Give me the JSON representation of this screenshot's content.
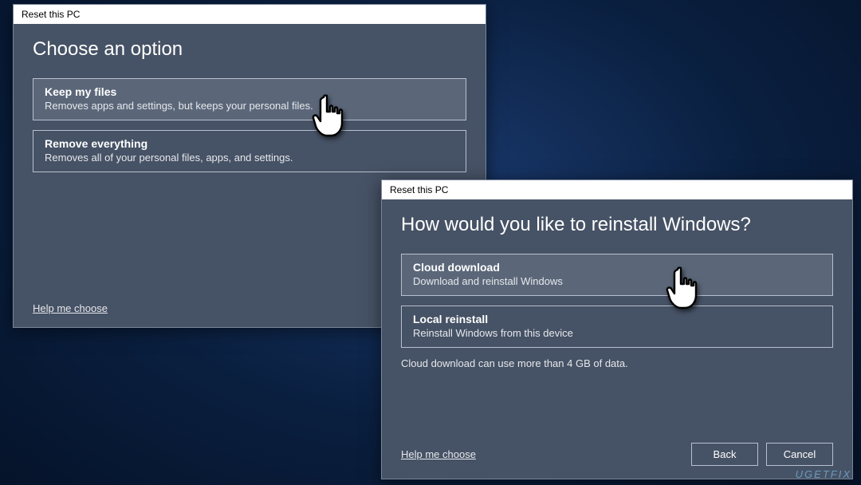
{
  "dialog1": {
    "title": "Reset this PC",
    "heading": "Choose an option",
    "options": [
      {
        "title": "Keep my files",
        "desc": "Removes apps and settings, but keeps your personal files."
      },
      {
        "title": "Remove everything",
        "desc": "Removes all of your personal files, apps, and settings."
      }
    ],
    "help": "Help me choose"
  },
  "dialog2": {
    "title": "Reset this PC",
    "heading": "How would you like to reinstall Windows?",
    "options": [
      {
        "title": "Cloud download",
        "desc": "Download and reinstall Windows"
      },
      {
        "title": "Local reinstall",
        "desc": "Reinstall Windows from this device"
      }
    ],
    "note": "Cloud download can use more than 4 GB of data.",
    "help": "Help me choose",
    "back": "Back",
    "cancel": "Cancel"
  },
  "watermark": "UGETFIX"
}
